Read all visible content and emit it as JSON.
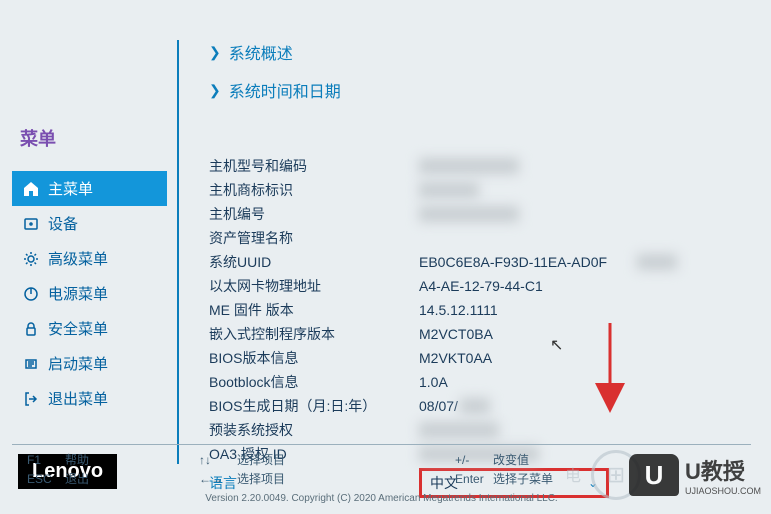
{
  "sidebar": {
    "title": "菜单",
    "items": [
      {
        "label": "主菜单",
        "icon": "home"
      },
      {
        "label": "设备",
        "icon": "devices"
      },
      {
        "label": "高级菜单",
        "icon": "gear"
      },
      {
        "label": "电源菜单",
        "icon": "power"
      },
      {
        "label": "安全菜单",
        "icon": "lock"
      },
      {
        "label": "启动菜单",
        "icon": "boot"
      },
      {
        "label": "退出菜单",
        "icon": "exit"
      }
    ]
  },
  "brand": "Lenovo",
  "sections": [
    {
      "label": "系统概述"
    },
    {
      "label": "系统时间和日期"
    }
  ],
  "info": [
    {
      "label": "主机型号和编码",
      "value": ""
    },
    {
      "label": "主机商标标识",
      "value": ""
    },
    {
      "label": "主机编号",
      "value": ""
    },
    {
      "label": "资产管理名称",
      "value": ""
    },
    {
      "label": "系统UUID",
      "value": "EB0C6E8A-F93D-11EA-AD0F"
    },
    {
      "label": "以太网卡物理地址",
      "value": "A4-AE-12-79-44-C1"
    },
    {
      "label": "ME 固件 版本",
      "value": "14.5.12.1111"
    },
    {
      "label": "嵌入式控制程序版本",
      "value": "M2VCT0BA"
    },
    {
      "label": "BIOS版本信息",
      "value": "M2VKT0AA"
    },
    {
      "label": "Bootblock信息",
      "value": "1.0A"
    },
    {
      "label": "BIOS生成日期（月:日:年）",
      "value": "08/07/"
    },
    {
      "label": "预装系统授权",
      "value": ""
    },
    {
      "label": "OA3 授权 ID",
      "value": ""
    }
  ],
  "language": {
    "label": "语言",
    "value": "中文"
  },
  "footer": {
    "keys": [
      [
        {
          "key": "F1",
          "action": "帮助"
        },
        {
          "key": "ESC",
          "action": "退出"
        }
      ],
      [
        {
          "key": "↑↓",
          "action": "选择项目"
        },
        {
          "key": "←→",
          "action": "选择项目"
        }
      ],
      [
        {
          "key": "+/-",
          "action": "改变值"
        },
        {
          "key": "Enter",
          "action": "选择子菜单"
        }
      ]
    ],
    "version": "Version 2.20.0049. Copyright (C) 2020 American Megatrends International LLC."
  },
  "watermark": {
    "circle_text": "⊞",
    "mid_text": "电",
    "u_badge": "U",
    "u_text": "U教授",
    "u_sub": "UJIAOSHOU.COM"
  }
}
